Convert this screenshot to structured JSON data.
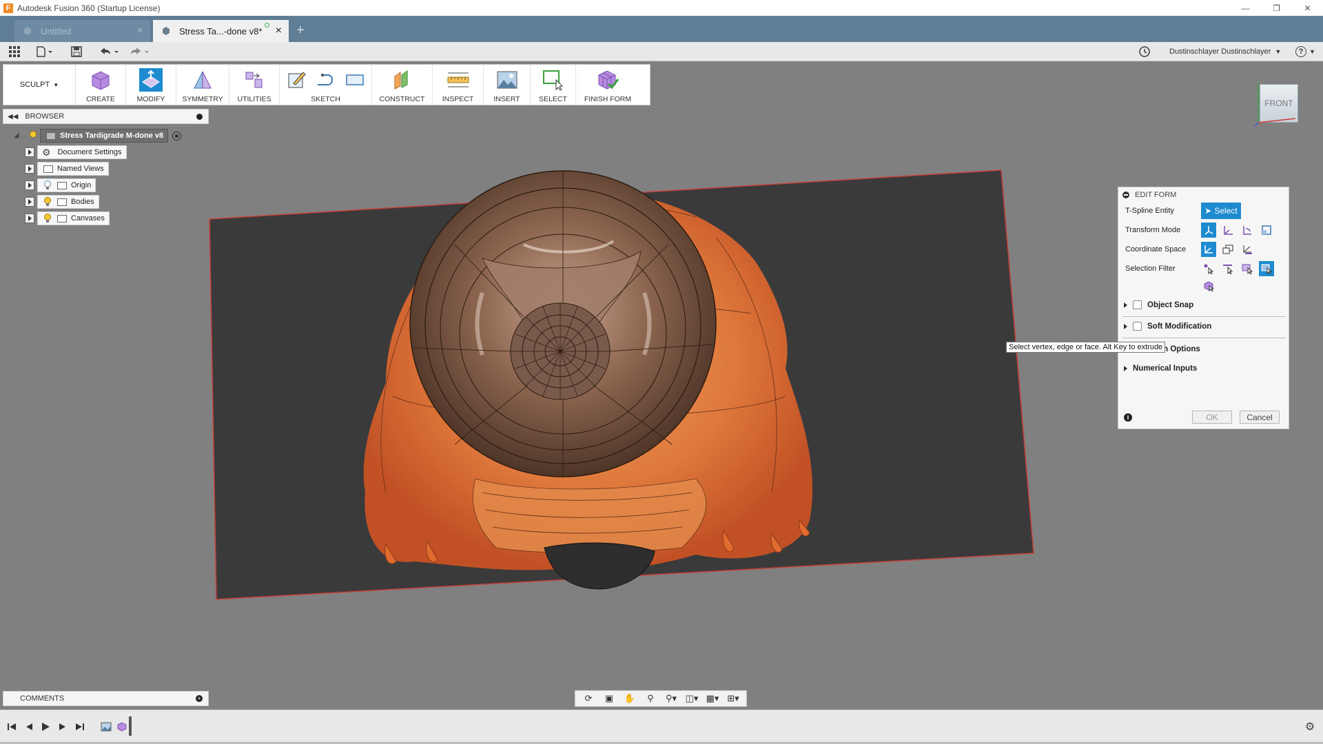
{
  "window": {
    "title": "Autodesk Fusion 360 (Startup License)",
    "controls": [
      "minimize",
      "restore",
      "close"
    ]
  },
  "tabs": [
    {
      "label": "Untitled",
      "active": false
    },
    {
      "label": "Stress Ta...-done v8*",
      "active": true
    }
  ],
  "quick_access": {
    "user": "Dustinschlayer Dustinschlayer",
    "help": "?"
  },
  "toolbar": {
    "workspace": "SCULPT",
    "groups": [
      "CREATE",
      "MODIFY",
      "SYMMETRY",
      "UTILITIES",
      "SKETCH",
      "CONSTRUCT",
      "INSPECT",
      "INSERT",
      "SELECT",
      "FINISH FORM"
    ]
  },
  "browser": {
    "title": "BROWSER",
    "root": "Stress Tardigrade M-done v8",
    "items": [
      "Document Settings",
      "Named Views",
      "Origin",
      "Bodies",
      "Canvases"
    ]
  },
  "viewcube": {
    "face": "FRONT"
  },
  "edit_form": {
    "title": "EDIT FORM",
    "rows": {
      "entity_label": "T-Spline Entity",
      "select_label": "Select",
      "transform_label": "Transform Mode",
      "coordinate_label": "Coordinate Space",
      "filter_label": "Selection Filter"
    },
    "sections": {
      "object_snap": "Object Snap",
      "soft_mod": "Soft Modification",
      "selection_options": "Selection Options",
      "numerical_inputs": "Numerical Inputs"
    },
    "ok": "OK",
    "cancel": "Cancel"
  },
  "tooltip": "Select vertex, edge or face. Alt Key to extrude",
  "comments": {
    "title": "COMMENTS"
  },
  "colors": {
    "accent": "#1e8bd0",
    "tabbar": "#5f7d95",
    "canvas_bg": "#808080",
    "plane": "#3a3a3a",
    "model": "#e8874a"
  }
}
